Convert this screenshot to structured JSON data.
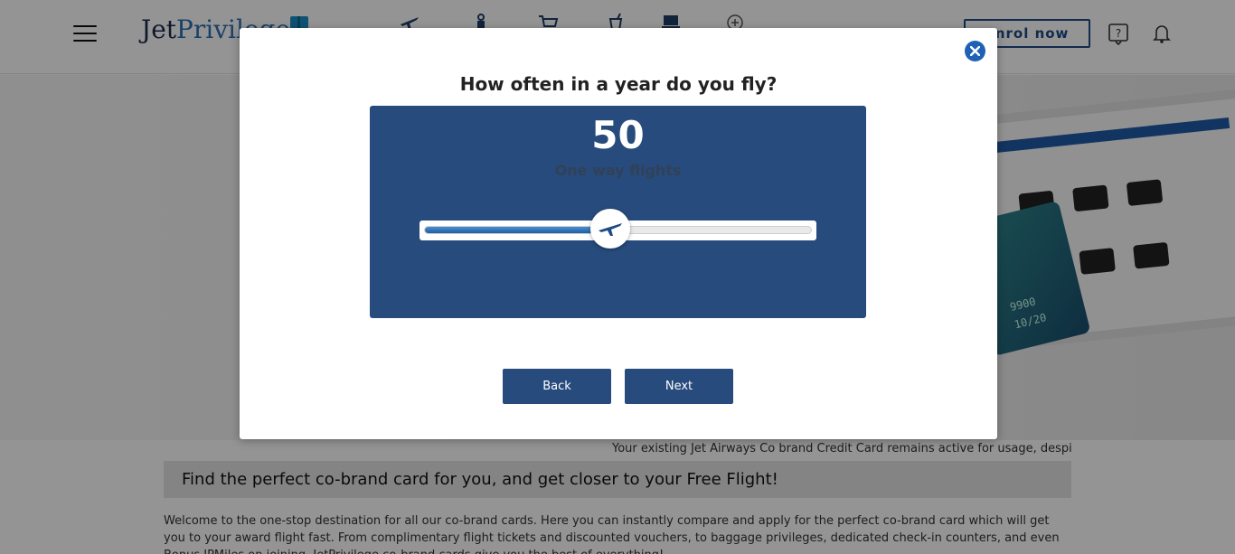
{
  "header": {
    "logo_part1": "Jet",
    "logo_part2": "Privilege",
    "nav_icons": [
      "card-icon",
      "flight-icon",
      "hotel-icon",
      "shopping-cart-icon",
      "dining-icon",
      "laptop-icon",
      "more-icon"
    ],
    "enrol_label": "Enrol now",
    "help_icon": "help-icon",
    "bell_icon": "bell-icon"
  },
  "hero": {
    "card_text1": "9900",
    "card_text2": "10/20"
  },
  "page": {
    "notice": "Your existing Jet Airways Co brand Credit Card remains active for usage, despite",
    "cobrand_heading": "Find the perfect co-brand card for you, and get closer to your Free Flight!",
    "intro": "Welcome to the one-stop destination for all our co-brand cards. Here you can instantly compare and apply for the perfect co-brand card which will get you to your award flight fast. From complimentary flight tickets and discounted vouchers, to baggage privileges, dedicated check-in counters, and even Bonus JPMiles on joining. JetPrivilege co-brand cards give you the best of everything!"
  },
  "modal": {
    "title": "How often in a year do you fly?",
    "flight_count": "50",
    "flight_unit": "One way flights",
    "slider_fraction": 0.48,
    "back_label": "Back",
    "next_label": "Next",
    "close_icon": "close-icon",
    "thumb_icon": "airplane-icon"
  },
  "colors": {
    "panel_bg": "#274b7c",
    "button_bg": "#274b7c",
    "close_bg": "#1f62b5",
    "brand": "#1e4b86"
  }
}
